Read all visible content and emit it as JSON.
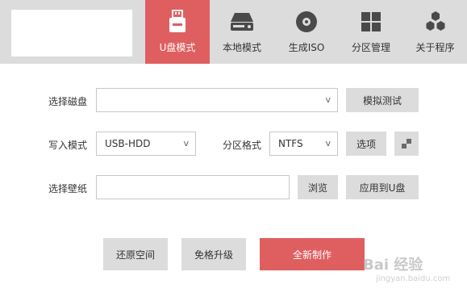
{
  "tabs": [
    {
      "label": "U盘模式",
      "icon": "usb-drive-icon",
      "active": true
    },
    {
      "label": "本地模式",
      "icon": "hard-disk-icon",
      "active": false
    },
    {
      "label": "生成ISO",
      "icon": "disc-icon",
      "active": false
    },
    {
      "label": "分区管理",
      "icon": "partition-grid-icon",
      "active": false
    },
    {
      "label": "关于程序",
      "icon": "hexagons-icon",
      "active": false
    }
  ],
  "form": {
    "disk_label": "选择磁盘",
    "disk_value": "",
    "simulate_button": "模拟测试",
    "write_mode_label": "写入模式",
    "write_mode_value": "USB-HDD",
    "partition_format_label": "分区格式",
    "partition_format_value": "NTFS",
    "options_button": "选项",
    "wallpaper_label": "选择壁纸",
    "wallpaper_value": "",
    "browse_button": "浏览",
    "apply_to_usb_button": "应用到U盘"
  },
  "actions": {
    "restore_space": "还原空间",
    "free_upgrade": "免格升级",
    "new_make": "全新制作"
  },
  "watermark": {
    "text": "Bai 经验",
    "sub": "jingyan.baidu.com"
  },
  "colors": {
    "accent": "#df5f60",
    "topbar": "#dcdcdc",
    "button": "#dcdcdc"
  }
}
